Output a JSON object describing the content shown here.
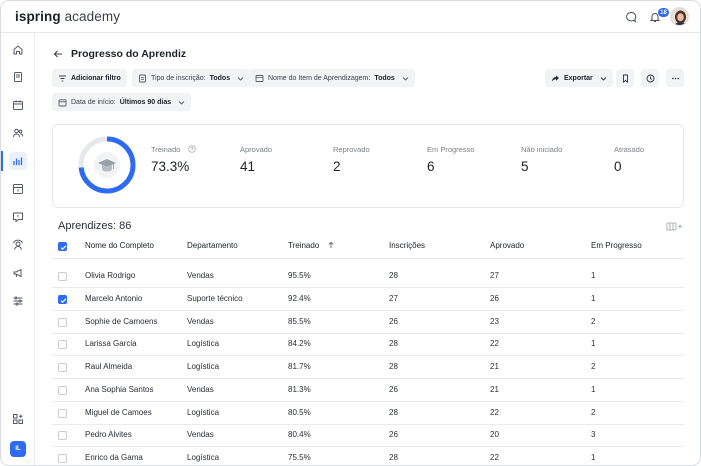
{
  "app": {
    "logo_bold": "ispring",
    "logo_light": "academy",
    "notification_count": "18",
    "user_initials": "IL"
  },
  "page": {
    "title": "Progresso do Aprendiz"
  },
  "filters": {
    "add_filter": "Adicionar filtro",
    "enrollment_label": "Tipo de inscrição:",
    "enrollment_value": "Todos",
    "item_label": "Nome do Item de Aprendizagem:",
    "item_value": "Todos",
    "date_label": "Data de início:",
    "date_value": "Últimos 90 dias",
    "export": "Exportar"
  },
  "stats": [
    {
      "label": "Treinado",
      "value": "73.3%"
    },
    {
      "label": "Aprovado",
      "value": "41"
    },
    {
      "label": "Reprovado",
      "value": "2"
    },
    {
      "label": "Em Progresso",
      "value": "6"
    },
    {
      "label": "Não iniciado",
      "value": "5"
    },
    {
      "label": "Atrasado",
      "value": "0"
    }
  ],
  "donut": {
    "fraction": 0.733,
    "color": "#2f6bf0",
    "track": "#e6e8eb"
  },
  "table": {
    "title": "Aprendizes: 86",
    "columns": [
      "Nome do Completo",
      "Departamento",
      "Treinado",
      "Inscrições",
      "Aprovado",
      "Em Progresso"
    ],
    "rows": [
      {
        "name": " Olivia Rodrigo",
        "dept": "Vendas",
        "trained": "95.5%",
        "enroll": "28",
        "approved": "27",
        "progress": "1",
        "checked": false
      },
      {
        "name": "Marcelo Antonio",
        "dept": "Suporte técnico",
        "trained": "92.4%",
        "enroll": "27",
        "approved": "26",
        "progress": "1",
        "checked": true
      },
      {
        "name": "Sophie de Camoens",
        "dept": "Vendas",
        "trained": "85.5%",
        "enroll": "26",
        "approved": "23",
        "progress": "2",
        "checked": false
      },
      {
        "name": "Larissa Garcia",
        "dept": "Logística",
        "trained": "84.2%",
        "enroll": "28",
        "approved": "22",
        "progress": "1",
        "checked": false
      },
      {
        "name": "Raul Almeida",
        "dept": "Logística",
        "trained": "81.7%",
        "enroll": "28",
        "approved": "21",
        "progress": "2",
        "checked": false
      },
      {
        "name": "Ana Sophia Santos",
        "dept": "Vendas",
        "trained": "81.3%",
        "enroll": "26",
        "approved": "21",
        "progress": "1",
        "checked": false
      },
      {
        "name": "Miguel de Camoes",
        "dept": "Logística",
        "trained": "80.5%",
        "enroll": "28",
        "approved": "22",
        "progress": "2",
        "checked": false
      },
      {
        "name": "Pedro Alvites",
        "dept": "Vendas",
        "trained": "80.4%",
        "enroll": "26",
        "approved": "20",
        "progress": "3",
        "checked": false
      },
      {
        "name": "Enrico da Gama",
        "dept": "Logística",
        "trained": "75.5%",
        "enroll": "28",
        "approved": "22",
        "progress": "1",
        "checked": false
      }
    ]
  }
}
